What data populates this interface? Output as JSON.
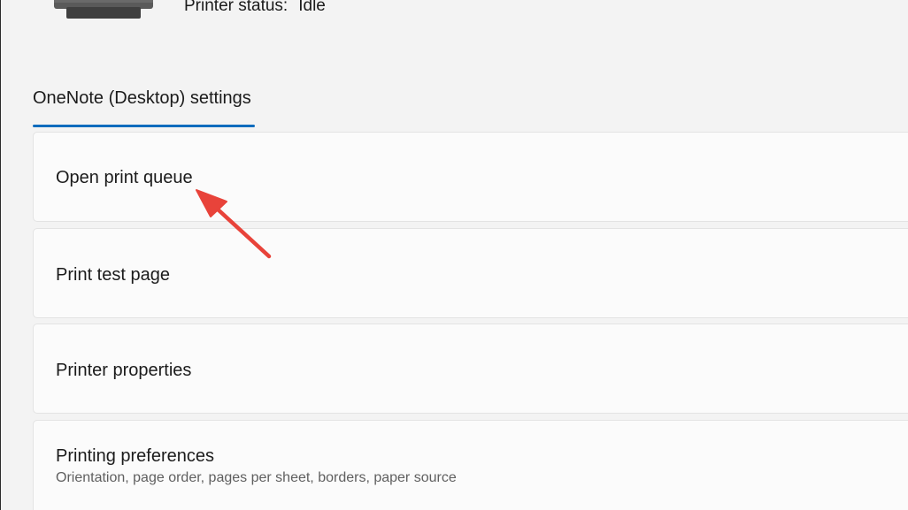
{
  "header": {
    "printer_status_label": "Printer status:",
    "printer_status_value": "Idle"
  },
  "tab": {
    "label": "OneNote (Desktop) settings"
  },
  "settings": {
    "items": [
      {
        "label": "Open print queue"
      },
      {
        "label": "Print test page"
      },
      {
        "label": "Printer properties"
      },
      {
        "label": "Printing preferences",
        "description": "Orientation, page order, pages per sheet, borders, paper source"
      }
    ]
  },
  "colors": {
    "accent": "#0f6cbd",
    "annotation_arrow": "#e8433a",
    "background": "#f3f3f3",
    "card": "#fbfbfb"
  },
  "icons": {
    "printer": "printer-icon",
    "annotation": "arrow-annotation-icon"
  }
}
